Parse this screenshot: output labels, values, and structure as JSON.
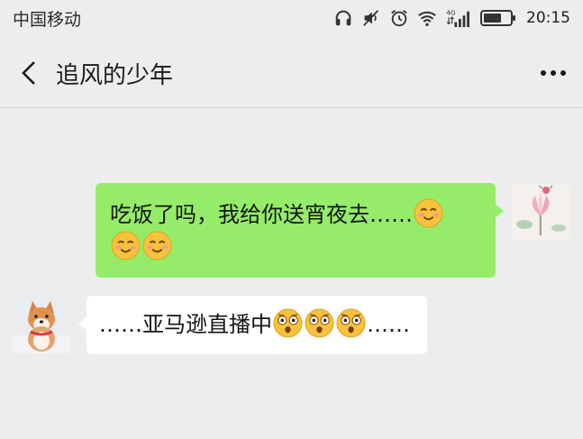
{
  "status_bar": {
    "carrier": "中国移动",
    "network_badge": "4G",
    "time": "20:15",
    "icons": [
      "headphones-icon",
      "mute-icon",
      "alarm-icon",
      "wifi-icon",
      "signal-4g-icon",
      "battery-icon"
    ]
  },
  "header": {
    "title": "追风的少年",
    "back_icon": "chevron-left-icon",
    "more_icon": "more-dots-icon"
  },
  "messages": [
    {
      "direction": "outgoing",
      "avatar": "lotus-avatar",
      "line1_text": "吃饭了吗，我给你送宵夜去……",
      "line1_emoji": "smiling-blush-emoji",
      "line2_emojis": [
        "smiling-blush-emoji",
        "smiling-blush-emoji"
      ]
    },
    {
      "direction": "incoming",
      "avatar": "shiba-dog-avatar",
      "prefix": "……亚马逊直播中",
      "emojis": [
        "flushed-emoji",
        "flushed-emoji",
        "flushed-emoji"
      ],
      "suffix": "……"
    }
  ],
  "colors": {
    "background": "#ededed",
    "outgoing_bubble": "#95ec69",
    "incoming_bubble": "#ffffff"
  }
}
